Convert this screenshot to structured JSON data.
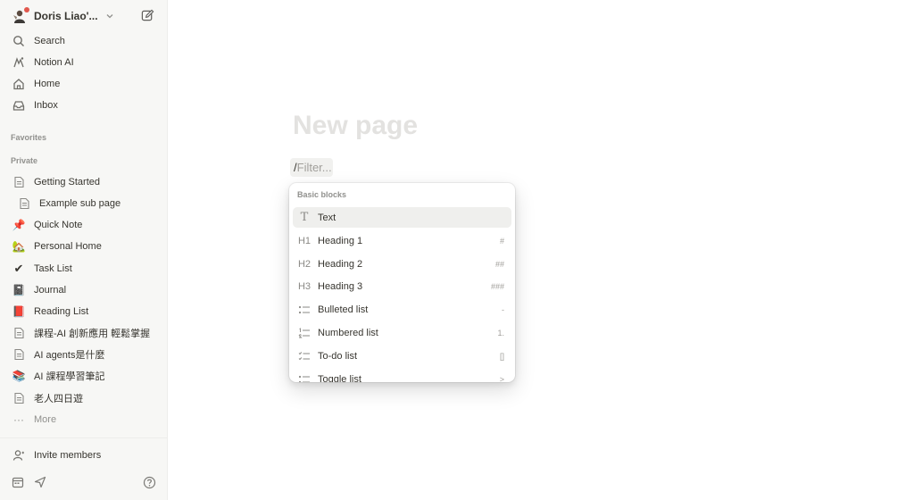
{
  "workspace": {
    "name": "Doris Liao'...",
    "avatar_icon": "person-avatar-icon",
    "notification_color": "#e1574c"
  },
  "nav": [
    {
      "label": "Search",
      "icon": "search-icon"
    },
    {
      "label": "Notion AI",
      "icon": "notion-ai-icon"
    },
    {
      "label": "Home",
      "icon": "home-icon"
    },
    {
      "label": "Inbox",
      "icon": "inbox-icon"
    }
  ],
  "sections": {
    "favorites": "Favorites",
    "private": "Private"
  },
  "pages": [
    {
      "label": "Getting Started",
      "icon": "page-icon"
    },
    {
      "label": "Example sub page",
      "icon": "page-icon"
    },
    {
      "label": "Quick Note",
      "icon": "pushpin-icon",
      "glyph": "📌"
    },
    {
      "label": "Personal Home",
      "icon": "house-icon",
      "glyph": "🏡"
    },
    {
      "label": "Task List",
      "icon": "checkmark-icon",
      "glyph": "✔"
    },
    {
      "label": "Journal",
      "icon": "notebook-icon",
      "glyph": "📓"
    },
    {
      "label": "Reading List",
      "icon": "book-icon",
      "glyph": "📕"
    },
    {
      "label": "課程-AI 創新應用 輕鬆掌握",
      "icon": "page-icon"
    },
    {
      "label": "AI agents是什麼",
      "icon": "page-icon"
    },
    {
      "label": "AI 課程學習筆記",
      "icon": "books-icon",
      "glyph": "📚"
    },
    {
      "label": "老人四日遊",
      "icon": "page-icon"
    },
    {
      "label": "More",
      "icon": "more-icon",
      "glyph": "···"
    }
  ],
  "footer": {
    "invite": "Invite members"
  },
  "editor": {
    "title_placeholder": "New page",
    "slash": "/",
    "filter_placeholder": "Filter..."
  },
  "menu": {
    "header": "Basic blocks",
    "items": [
      {
        "label": "Text",
        "icon": "text-icon",
        "glyph": "T",
        "shortcut": ""
      },
      {
        "label": "Heading 1",
        "icon": "heading1-icon",
        "glyph": "H1",
        "shortcut": "#"
      },
      {
        "label": "Heading 2",
        "icon": "heading2-icon",
        "glyph": "H2",
        "shortcut": "##"
      },
      {
        "label": "Heading 3",
        "icon": "heading3-icon",
        "glyph": "H3",
        "shortcut": "###"
      },
      {
        "label": "Bulleted list",
        "icon": "bulleted-list-icon",
        "glyph": "",
        "shortcut": "-"
      },
      {
        "label": "Numbered list",
        "icon": "numbered-list-icon",
        "glyph": "",
        "shortcut": "1."
      },
      {
        "label": "To-do list",
        "icon": "todo-list-icon",
        "glyph": "",
        "shortcut": "[]"
      },
      {
        "label": "Toggle list",
        "icon": "toggle-list-icon",
        "glyph": "",
        "shortcut": ">"
      }
    ]
  }
}
